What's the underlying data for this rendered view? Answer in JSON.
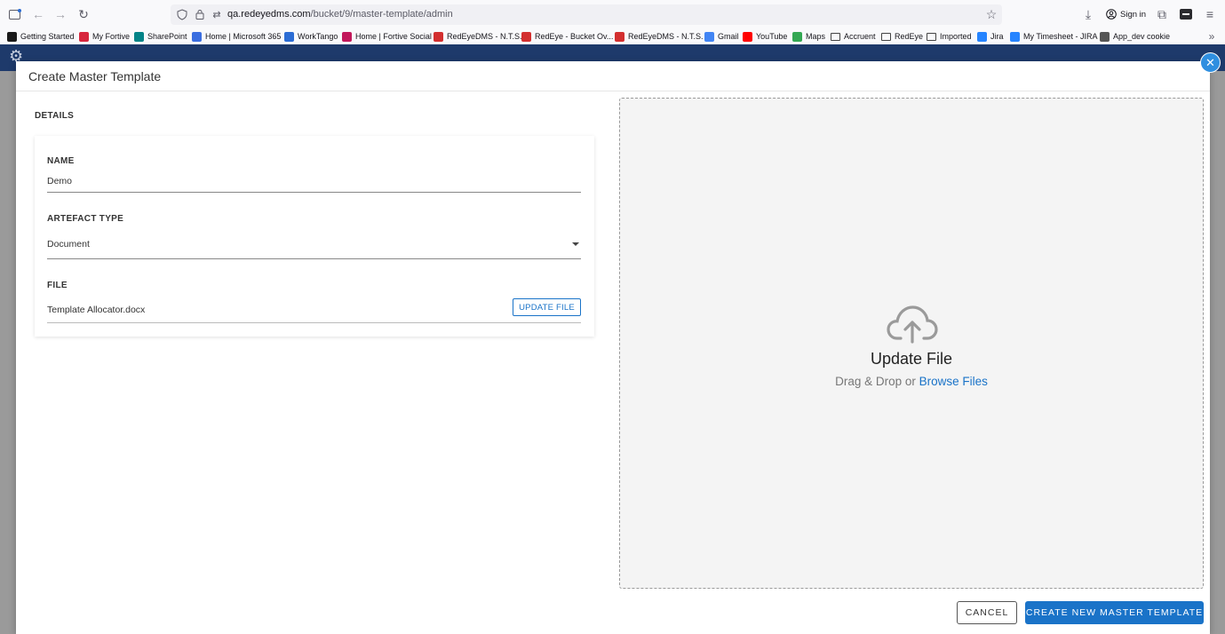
{
  "browser": {
    "url_host": "qa.redeyedms.com",
    "url_path": "/bucket/9/master-template/admin",
    "signin_label": "Sign in"
  },
  "bookmarks": [
    {
      "label": "Getting Started",
      "icon": "firefox-icon",
      "color": "#1a1a1a"
    },
    {
      "label": "My Fortive",
      "icon": "fortive-icon",
      "color": "#d7263d"
    },
    {
      "label": "SharePoint",
      "icon": "sharepoint-icon",
      "color": "#038387"
    },
    {
      "label": "Home | Microsoft 365",
      "icon": "m365-icon",
      "color": "#3b6ee0"
    },
    {
      "label": "WorkTango",
      "icon": "worktango-icon",
      "color": "#2b6cd4"
    },
    {
      "label": "Home | Fortive Social",
      "icon": "fortive-social-icon",
      "color": "#c2185b"
    },
    {
      "label": "RedEyeDMS - N.T.S.",
      "icon": "redeye-icon",
      "color": "#d32f2f"
    },
    {
      "label": "RedEye - Bucket Ov...",
      "icon": "redeye-icon",
      "color": "#d32f2f"
    },
    {
      "label": "RedEyeDMS - N.T.S.",
      "icon": "redeye-icon",
      "color": "#d32f2f"
    },
    {
      "label": "Gmail",
      "icon": "google-icon",
      "color": "#4285f4"
    },
    {
      "label": "YouTube",
      "icon": "youtube-icon",
      "color": "#ff0000"
    },
    {
      "label": "Maps",
      "icon": "maps-icon",
      "color": "#34a853"
    },
    {
      "label": "Accruent",
      "icon": "folder-icon",
      "color": "#444444"
    },
    {
      "label": "RedEye",
      "icon": "folder-icon",
      "color": "#444444"
    },
    {
      "label": "Imported",
      "icon": "folder-icon",
      "color": "#444444"
    },
    {
      "label": "Jira",
      "icon": "jira-icon",
      "color": "#2684ff"
    },
    {
      "label": "My Timesheet - JIRA",
      "icon": "jira-icon",
      "color": "#2684ff"
    },
    {
      "label": "App_dev cookie",
      "icon": "globe-icon",
      "color": "#555555"
    }
  ],
  "modal": {
    "title": "Create Master Template",
    "close_symbol": "✕",
    "details_label": "DETAILS",
    "name_label": "NAME",
    "name_value": "Demo",
    "artefact_label": "ARTEFACT TYPE",
    "artefact_value": "Document",
    "file_label": "FILE",
    "file_value": "Template Allocator.docx",
    "update_file_button": "UPDATE FILE",
    "dropzone_title": "Update File",
    "dropzone_text": "Drag & Drop or",
    "dropzone_link": "Browse Files",
    "cancel_button": "CANCEL",
    "create_button": "CREATE NEW MASTER TEMPLATE"
  },
  "colors": {
    "accent": "#1a73c8",
    "app_header": "#1e3a6b",
    "close_button": "#2f8fe0"
  }
}
